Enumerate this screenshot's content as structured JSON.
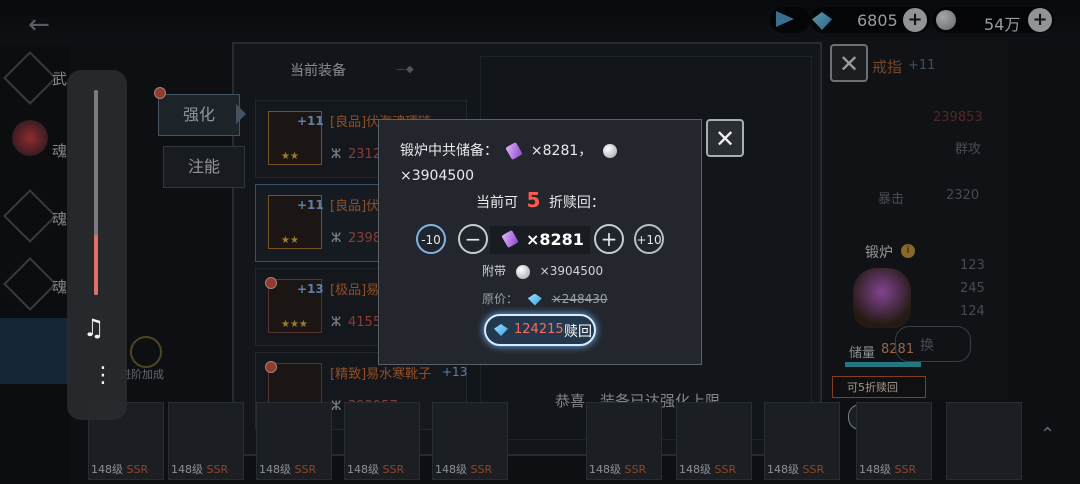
{
  "topbar": {
    "gem_count": "6805",
    "silver_count": "54万"
  },
  "left_menu": [
    {
      "label": "武"
    },
    {
      "label": "魂"
    },
    {
      "label": "魂"
    },
    {
      "label": "魂"
    }
  ],
  "left_extra": {
    "label": "进阶加成"
  },
  "panel": {
    "section_title": "当前装备",
    "tab_strengthen": "强化",
    "tab_inject": "注能",
    "equipment": [
      {
        "name": "[良品]伏海魂项链",
        "plus": "+11",
        "level": "+11",
        "power": "2312",
        "stars": "★★"
      },
      {
        "name": "[良品]伏",
        "plus": "+11",
        "level": "",
        "power": "2398",
        "stars": "★★"
      },
      {
        "name": "[极品]易",
        "plus": "+13",
        "level": "",
        "power": "4155",
        "stars": "★★★"
      },
      {
        "name": "[精致]易水寒靴子",
        "plus": "+13",
        "level": "+13",
        "power": "393957",
        "stars": "★"
      }
    ],
    "congrats": "恭喜，装备已达强化上限"
  },
  "right_info": {
    "item_name": "戒指",
    "item_plus": "+11",
    "stat_power": "239853",
    "stat_type": "群攻",
    "stat_crit_label": "暴击",
    "stat_crit": "2320",
    "rows": [
      "123",
      "245",
      "124"
    ],
    "forge_label": "锻炉",
    "storage_label": "储量",
    "storage_value": "8281",
    "discount_text": "可5折赎回",
    "redeem_small": "赎回",
    "exchange_partial": "换"
  },
  "modal": {
    "line1": "锻炉中共储备：",
    "crystal_count": "×8281，",
    "silver_total": "×3904500",
    "discount_prefix": "当前可",
    "discount_num": "5",
    "discount_suffix": "折赎回：",
    "btn_minus10": "-10",
    "btn_plus10": "+10",
    "btn_minus": "−",
    "btn_plus": "+",
    "qty": "×8281",
    "attach_label": "附带",
    "attach_value": "×3904500",
    "orig_label": "原价：",
    "orig_value": "×248430",
    "price": "124215",
    "redeem_label": "赎回"
  },
  "bottom_cards": [
    {
      "level": "148级",
      "rank": "SSR"
    },
    {
      "level": "148级",
      "rank": "SSR"
    },
    {
      "level": "148级",
      "rank": "SSR"
    },
    {
      "level": "148级",
      "rank": "SSR"
    },
    {
      "level": "148级",
      "rank": "SSR"
    },
    {
      "level": "148级",
      "rank": "SSR"
    },
    {
      "level": "148级",
      "rank": "SSR"
    },
    {
      "level": "148级",
      "rank": "SSR"
    },
    {
      "level": "148级",
      "rank": "SSR"
    }
  ]
}
